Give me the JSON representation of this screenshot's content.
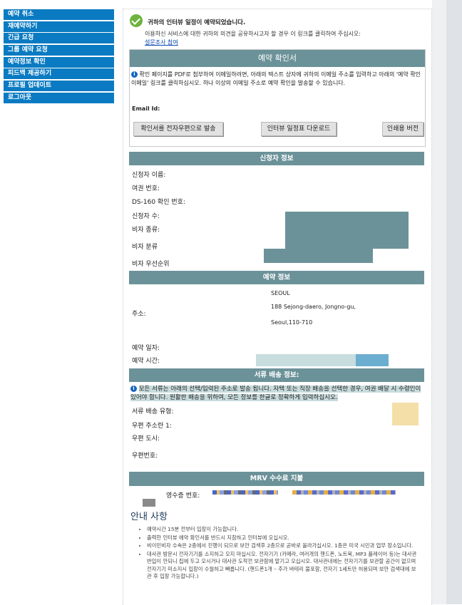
{
  "sidebar": {
    "items": [
      {
        "label": "예약 취소"
      },
      {
        "label": "재예약하기"
      },
      {
        "label": "긴급 요청"
      },
      {
        "label": "그룹 예약 요청"
      },
      {
        "label": "예약정보 확인"
      },
      {
        "label": "피드백 제공하기"
      },
      {
        "label": "프로필 업데이트"
      },
      {
        "label": "로그아웃"
      }
    ]
  },
  "success": {
    "title": "귀하의 인터뷰 일정이 예약되었습니다.",
    "description": "이용하신 서비스에 대한 귀하의 의견을 공유하시고자 할 경우 이 링크를 클릭하여 주십시오:",
    "survey_link": "설문조사 참여"
  },
  "confirmation": {
    "title": "예약 확인서",
    "note": "확인 페이지를 PDF로 첨부하여 이메일하려면, 아래의 텍스트 상자에 귀하의 이메일 주소를 입력하고 아래의 '예약 확인 이메일' 링크를 클릭하십시오. 하나 이상의 이메일 주소로 예약 확인을 발송할 수 있습니다.",
    "email_label": "Email Id:",
    "buttons": {
      "send_mail": "확인서를 전자우편으로 발송",
      "download": "인터뷰 일정표 다운로드",
      "print": "인쇄용 버전"
    }
  },
  "applicant": {
    "title": "신청자 정보",
    "fields": {
      "name": "신청자 이름:",
      "passport": "여권 번호:",
      "ds160": "DS-160 확인 번호:",
      "count": "신청자 수:",
      "visa_type": "비자 종류:",
      "visa_class": "비자 분류",
      "priority": "비자 우선순위"
    }
  },
  "appointment": {
    "title": "예약 정보",
    "address_label": "주소:",
    "address_lines": [
      "SEOUL",
      "188 Sejong-daero, Jongno-gu,",
      "Seoul,110-710"
    ],
    "date_label": "예약 일자:",
    "time_label": "예약 시간:"
  },
  "delivery": {
    "title": "서류 배송 정보:",
    "note": "모든 서류는 아래의 선택/입력된 주소로 발송 됩니다. 자택 또는 직장 배송을 선택한 경우, 여권 배달 시 수령인이 있어야 합니다. 원활한 배송을 위하여, 모든 정보를 한글로 정확하게 입력하십시오.",
    "type_label": "서류 배송 유형:",
    "address1_label": "우편 주소란 1:",
    "city_label": "우편 도시:",
    "zip_label": "우편번호:"
  },
  "mrv": {
    "title": "MRV 수수료 지불",
    "receipt_label": "영수증 번호:"
  },
  "guide": {
    "title": "안내 사항",
    "items": [
      "예약시간 15분 전부터 입장이 가능합니다.",
      "출력한 인터뷰 예약 확인서를 반드시 지참하고 인터뷰에 오십시오.",
      "비이민비자 수속은 2층에서 진행이 되므로 보안 검색후 2층으로 곧바로 올라가십시오. 1층은 미국 시민과 업무 장소입니다.",
      "대사관 방문시 전자기기를 소지하고 오지 마십시오. 전자기기 (카메라, 여러개의 핸드폰, 노트북, MP3 플레이어 등)는 대사관 반입이 안되니 집에 두고 오시거나 대사관 도착전 보관함에 맡기고 오십시오. 대사관내에는 전자기기를 보관할 공간이 없으며 전자기기 미소지시 입장이 수월하고 빠릅니다. (핸드폰1개 – 추가 바테리 불포함, 전자기 1세트만 허용되며 보안 검색대에 보관 후 입장 가능합니다.)"
    ]
  },
  "colors": {
    "nav_bg": "#0a7bc2",
    "section_bar": "#6c9299",
    "success_green": "#6cb33f",
    "link": "#0645ad"
  }
}
